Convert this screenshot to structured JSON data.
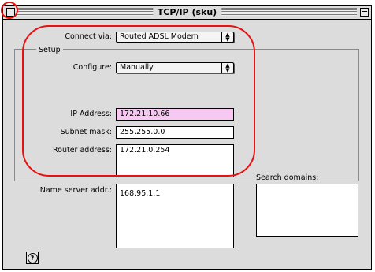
{
  "window": {
    "title": "TCP/IP (sku)"
  },
  "connect": {
    "label": "Connect via:",
    "value": "Routed ADSL Modem"
  },
  "setup": {
    "group_title": "Setup",
    "configure_label": "Configure:",
    "configure_value": "Manually",
    "ip_label": "IP Address:",
    "ip_value": "172.21.10.66",
    "subnet_label": "Subnet mask:",
    "subnet_value": "255.255.0.0",
    "router_label": "Router address:",
    "router_value": "172.21.0.254",
    "nameserver_label": "Name server addr.:",
    "nameserver_value": "168.95.1.1",
    "search_label": "Search domains:",
    "search_value": ""
  },
  "help": {
    "label": "?"
  },
  "colors": {
    "ip_field_bg": "#f7c9f2",
    "annotation": "#e81010"
  }
}
